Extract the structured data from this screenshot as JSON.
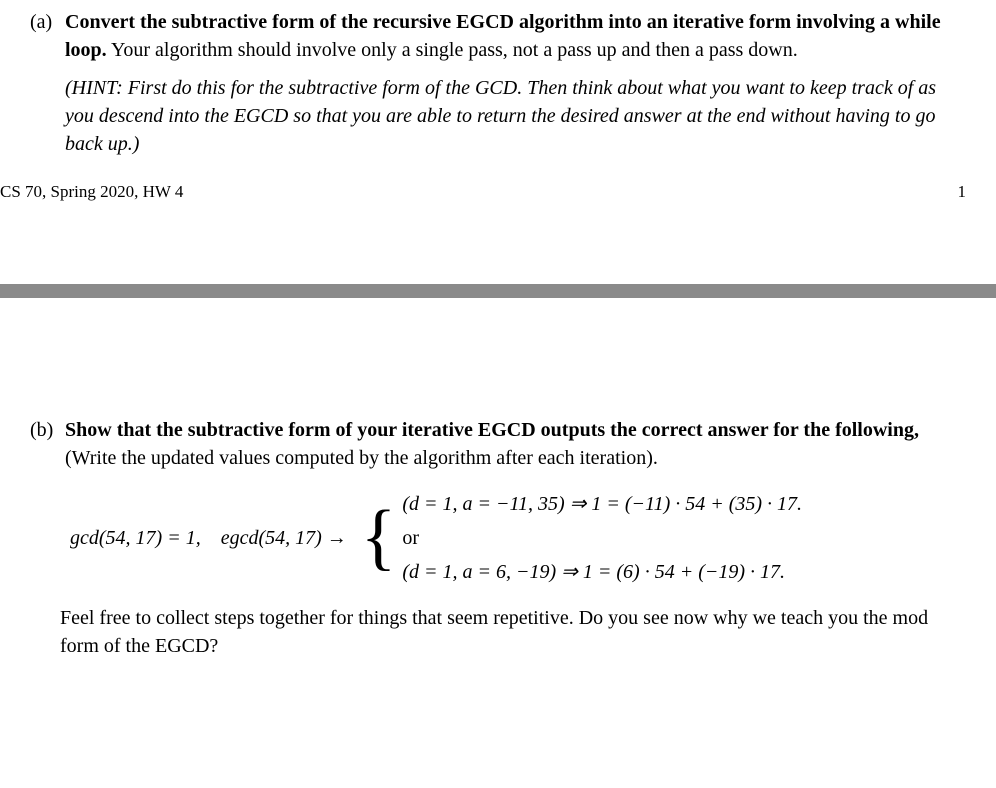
{
  "partA": {
    "label": "(a)",
    "boldText": "Convert the subtractive form of the recursive EGCD algorithm into an iterative form involving a while loop.",
    "normalText": " Your algorithm should involve only a single pass, not a pass up and then a pass down.",
    "hint": "(HINT: First do this for the subtractive form of the GCD. Then think about what you want to keep track of as you descend into the EGCD so that you are able to return the desired answer at the end without having to go back up.)"
  },
  "footer": {
    "left": "CS 70, Spring 2020, HW 4",
    "right": "1"
  },
  "partB": {
    "label": "(b)",
    "boldText": "Show that the subtractive form of your iterative EGCD outputs the correct answer for the following,",
    "normalText": " (Write the updated values computed by the algorithm after each iteration).",
    "math": {
      "left": "gcd(54, 17) = 1, egcd(54, 17) →",
      "case1": "(d = 1, a = −11, 35) ⇒ 1 = (−11) · 54 + (35) · 17.",
      "or": "or",
      "case2": "(d = 1, a = 6, −19) ⇒ 1 = (6) · 54 + (−19) · 17."
    },
    "followup": "Feel free to collect steps together for things that seem repetitive. Do you see now why we teach you the mod form of the EGCD?"
  }
}
